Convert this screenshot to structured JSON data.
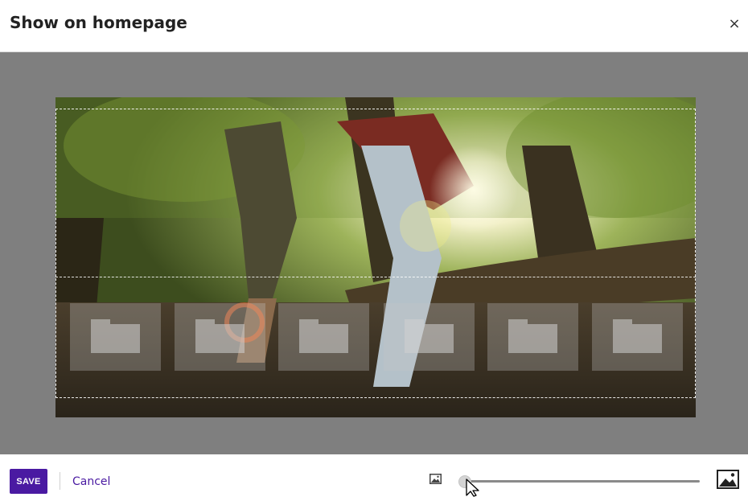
{
  "modal": {
    "title": "Show on homepage",
    "close_label": "×"
  },
  "preview": {
    "icon": "folder-icon",
    "tile_count": 6
  },
  "footer": {
    "save_label": "SAVE",
    "cancel_label": "Cancel",
    "zoom_out_icon": "image-small-icon",
    "zoom_in_icon": "image-large-icon",
    "zoom_level": 0
  },
  "colors": {
    "accent": "#4a1aa2",
    "overlay": "#7f7f7f"
  }
}
